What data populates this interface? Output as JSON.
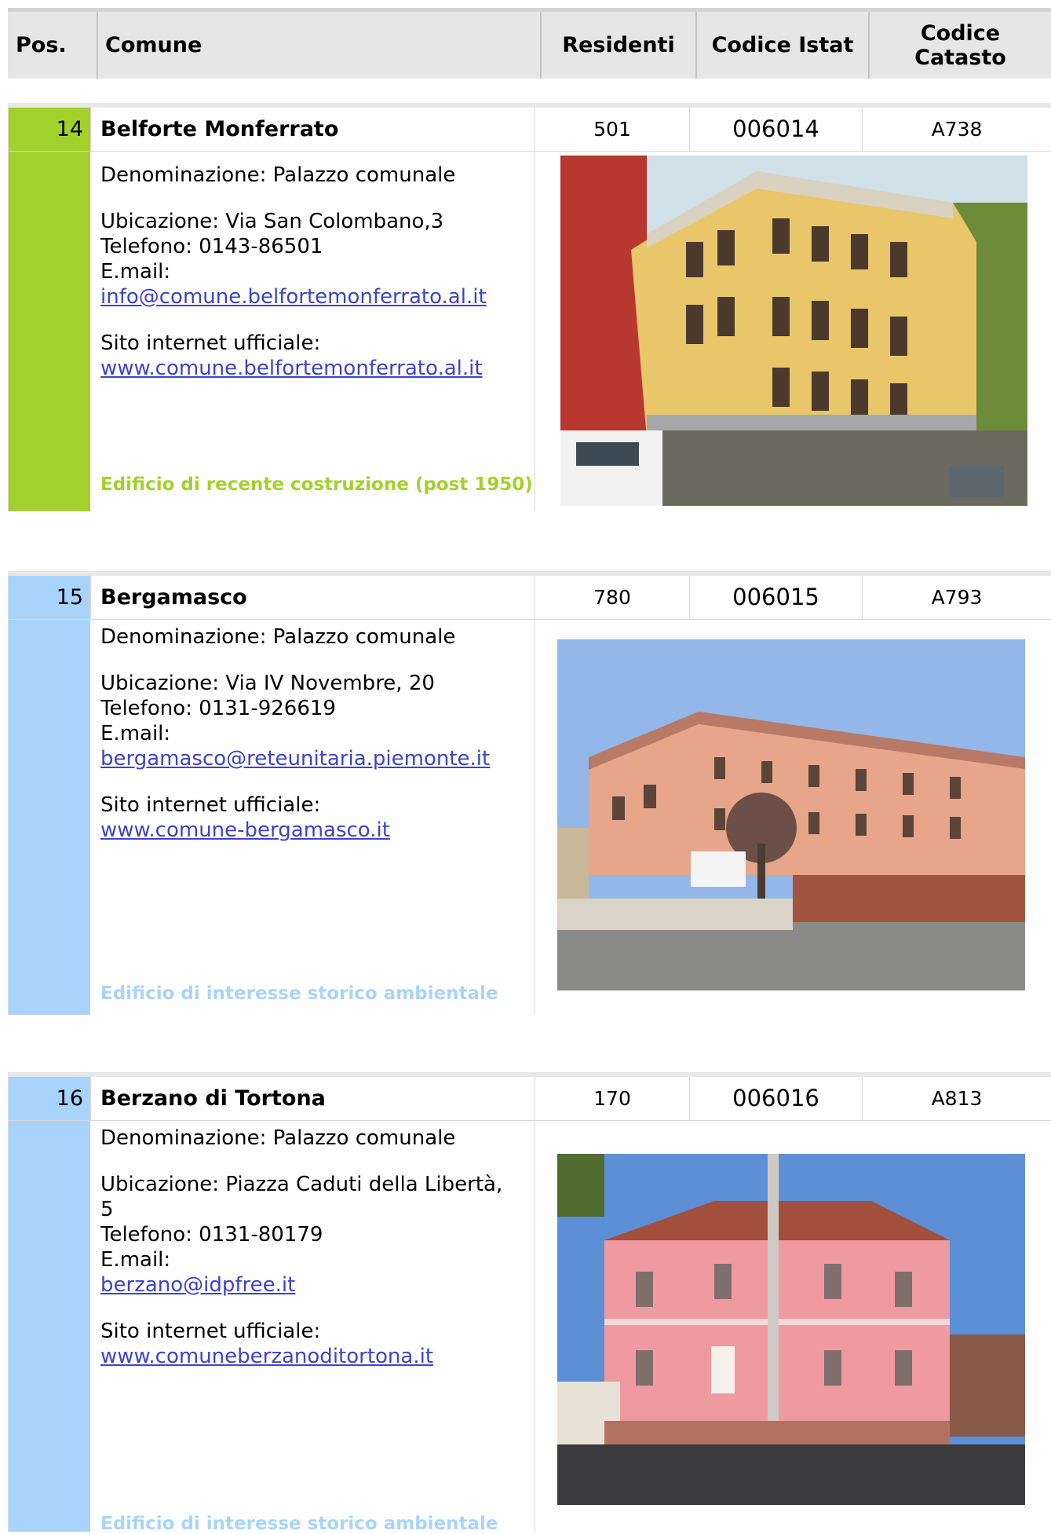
{
  "header": {
    "pos": "Pos.",
    "comune": "Comune",
    "residenti": "Residenti",
    "codice_istat": "Codice Istat",
    "codice_catasto_line1": "Codice",
    "codice_catasto_line2": "Catasto"
  },
  "entries": [
    {
      "pos": "14",
      "name": "Belforte Monferrato",
      "residenti": "501",
      "istat": "006014",
      "catasto": "A738",
      "denominazione": "Denominazione: Palazzo comunale",
      "ubicazione": "Ubicazione: Via San Colombano,3",
      "telefono": "Telefono: 0143-86501",
      "email_label": "E.mail:",
      "email": "info@comune.belfortemonferrato.al.it",
      "sito_label": "Sito internet ufficiale:",
      "sito": "www.comune.belfortemonferrato.al.it",
      "note": "Edificio di recente costruzione (post 1950)",
      "strip_color": "#a3d12c"
    },
    {
      "pos": "15",
      "name": "Bergamasco",
      "residenti": "780",
      "istat": "006015",
      "catasto": "A793",
      "denominazione": "Denominazione: Palazzo comunale",
      "ubicazione": "Ubicazione: Via IV Novembre, 20",
      "telefono": "Telefono: 0131-926619",
      "email_label": "E.mail:",
      "email": "bergamasco@reteunitaria.piemonte.it",
      "sito_label": "Sito internet ufficiale:",
      "sito": "www.comune-bergamasco.it",
      "note": "Edificio di interesse storico ambientale",
      "strip_color": "#a8d4fb"
    },
    {
      "pos": "16",
      "name": "Berzano di Tortona",
      "residenti": "170",
      "istat": "006016",
      "catasto": "A813",
      "denominazione": "Denominazione: Palazzo comunale",
      "ubicazione_a": "Ubicazione: Piazza Caduti della Libertà,",
      "ubicazione_b": "5",
      "telefono": "Telefono: 0131-80179",
      "email_label": "E.mail:",
      "email": "berzano@idpfree.it",
      "sito_label": "Sito internet ufficiale:",
      "sito": "www.comuneberzanoditortona.it",
      "note": "Edificio di interesse storico ambientale",
      "strip_color": "#a8d4fb"
    }
  ]
}
